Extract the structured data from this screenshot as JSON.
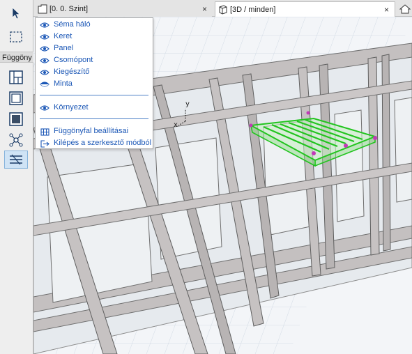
{
  "toolbox": {
    "label": "Függöny",
    "tools": [
      {
        "name": "arrow-tool",
        "icon": "arrow-pointer-icon"
      },
      {
        "name": "marquee-tool",
        "icon": "marquee-icon"
      },
      {
        "name": "curtain-wall-scheme-tool",
        "icon": "grid-scheme-icon"
      },
      {
        "name": "frame-tool",
        "icon": "frame-icon"
      },
      {
        "name": "panel-tool",
        "icon": "panel-icon"
      },
      {
        "name": "junction-tool",
        "icon": "junction-icon"
      },
      {
        "name": "accessory-tool",
        "icon": "accessory-icon",
        "selected": true
      }
    ]
  },
  "tabs": {
    "floorplan": {
      "label": "[0. 0. Szint]",
      "close": "×",
      "icon": "floorplan-icon"
    },
    "view3d": {
      "label": "[3D / minden]",
      "close": "×",
      "icon": "cube-3d-icon"
    },
    "extra_icon": "house-icon"
  },
  "menu": {
    "items": [
      {
        "label": "Séma háló",
        "icon": "eye-icon"
      },
      {
        "label": "Keret",
        "icon": "eye-icon"
      },
      {
        "label": "Panel",
        "icon": "eye-icon"
      },
      {
        "label": "Csomópont",
        "icon": "eye-icon"
      },
      {
        "label": "Kiegészítő",
        "icon": "eye-icon"
      },
      {
        "label": "Minta",
        "icon": "eye-half-icon"
      }
    ],
    "environment": {
      "label": "Környezet",
      "icon": "eye-icon"
    },
    "settings": {
      "label": "Függönyfal beállításai",
      "icon": "curtain-wall-settings-icon"
    },
    "exit": {
      "label": "Kilépés a szerkesztő módból",
      "icon": "exit-icon"
    }
  },
  "axes": {
    "y": "y",
    "x": "x"
  },
  "colors": {
    "menu_text": "#1b57b6",
    "selection_green": "#22c41f",
    "handle_magenta": "#c23ab8",
    "wall_gray": "#c6c2c2",
    "glass_gray": "#e9edf0"
  }
}
